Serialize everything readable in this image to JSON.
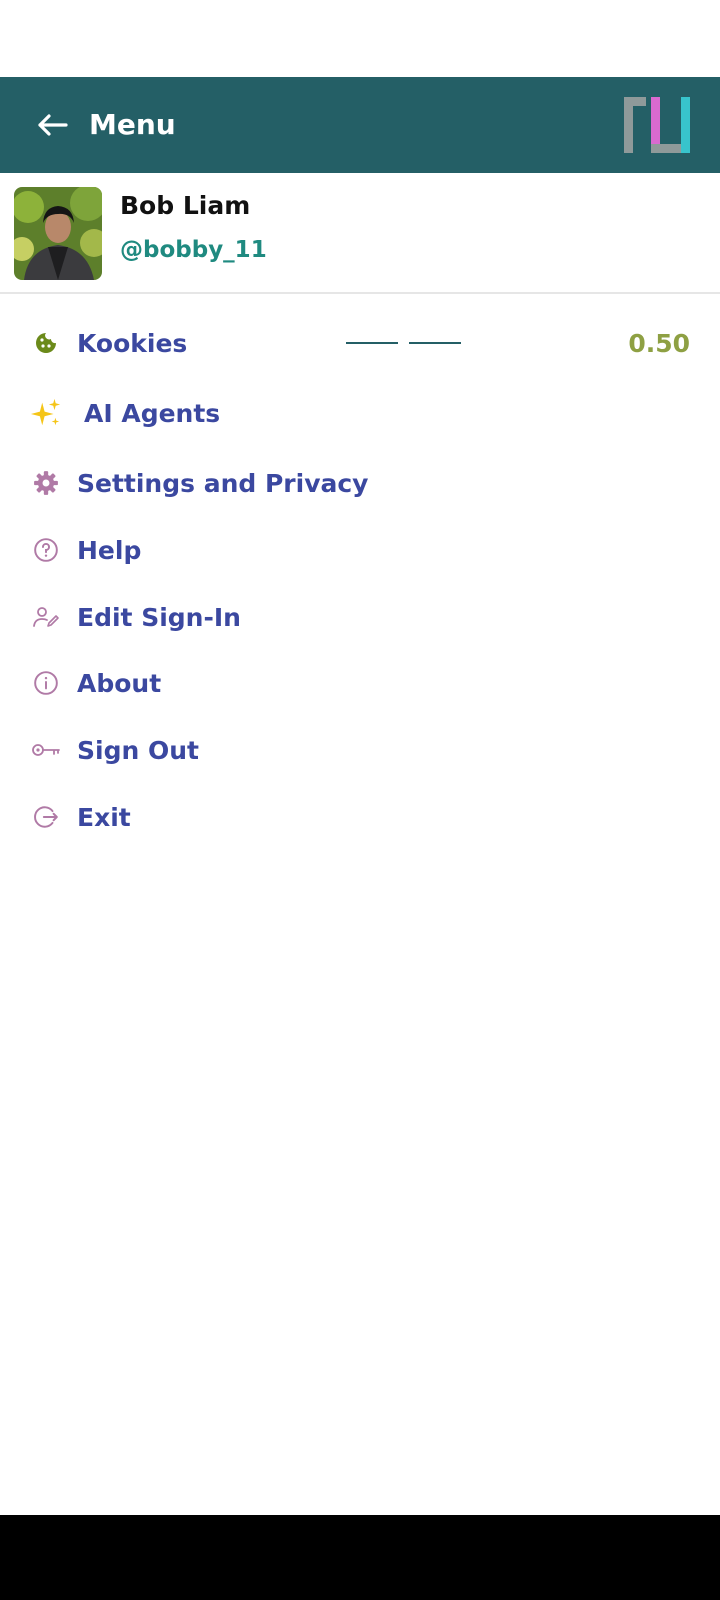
{
  "app_bar": {
    "title": "Menu",
    "background": "#245f66"
  },
  "profile": {
    "name": "Bob Liam",
    "handle": "@bobby_11"
  },
  "menu": {
    "items": [
      {
        "label": "Kookies",
        "icon": "cookie-icon"
      },
      {
        "label": "AI Agents",
        "icon": "sparkles-icon"
      },
      {
        "label": "Settings and Privacy",
        "icon": "gear-icon"
      },
      {
        "label": "Help",
        "icon": "help-circle-icon"
      },
      {
        "label": "Edit Sign-In",
        "icon": "user-edit-icon"
      },
      {
        "label": "About",
        "icon": "info-circle-icon"
      },
      {
        "label": "Sign Out",
        "icon": "key-icon"
      },
      {
        "label": "Exit",
        "icon": "exit-icon"
      }
    ],
    "kookies_value": "0.50"
  },
  "colors": {
    "label": "#3b48a0",
    "handle": "#1f8a80",
    "value": "#8ea043",
    "icon": "#b07aa6"
  }
}
